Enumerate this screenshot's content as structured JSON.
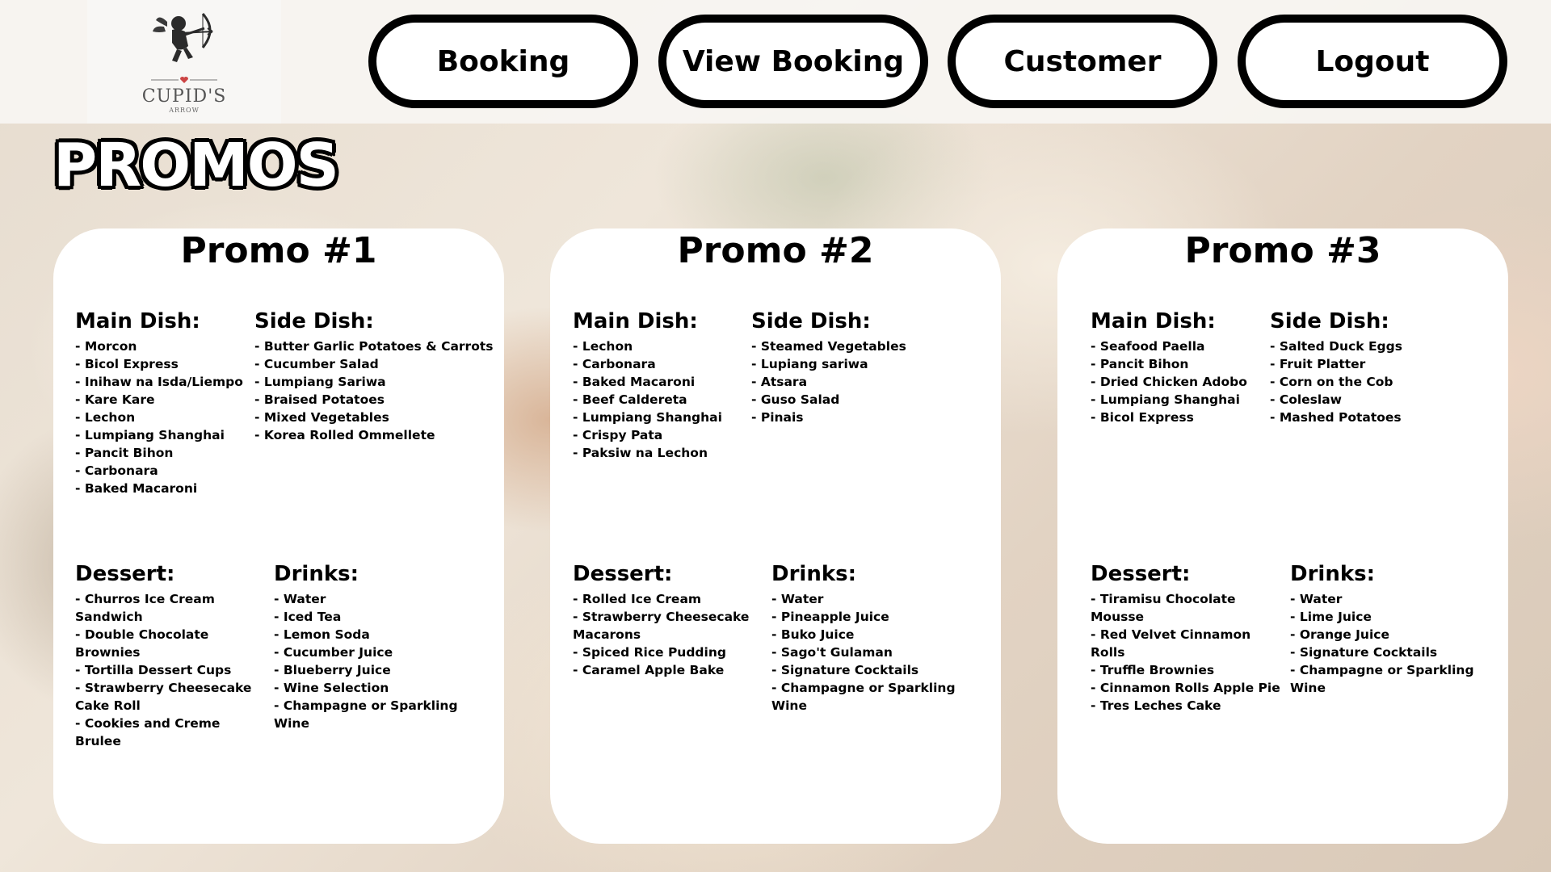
{
  "logo": {
    "name": "CUPID'S",
    "sub": "ARROW"
  },
  "nav": {
    "booking": "Booking",
    "view_booking": "View Booking",
    "customer": "Customer",
    "logout": "Logout"
  },
  "page_title": "PROMOS",
  "promos": [
    {
      "title": "Promo #1",
      "main_label": "Main Dish:",
      "main": [
        "- Morcon",
        "- Bicol Express",
        "- Inihaw na Isda/Liempo",
        "- Kare Kare",
        "- Lechon",
        "- Lumpiang Shanghai",
        "- Pancit Bihon",
        "- Carbonara",
        "- Baked Macaroni"
      ],
      "side_label": "Side Dish:",
      "side": [
        "- Butter Garlic Potatoes & Carrots",
        "- Cucumber Salad",
        "- Lumpiang Sariwa",
        "- Braised Potatoes",
        "- Mixed Vegetables",
        "- Korea Rolled Ommellete"
      ],
      "dessert_label": "Dessert:",
      "dessert": [
        "- Churros Ice Cream",
        "Sandwich",
        "- Double Chocolate",
        "Brownies",
        "- Tortilla Dessert Cups",
        "- Strawberry Cheesecake",
        "Cake Roll",
        "- Cookies and Creme",
        "Brulee"
      ],
      "drinks_label": "Drinks:",
      "drinks": [
        "- Water",
        "- Iced Tea",
        "- Lemon Soda",
        "- Cucumber Juice",
        "- Blueberry Juice",
        "- Wine Selection",
        "- Champagne or Sparkling",
        "Wine"
      ]
    },
    {
      "title": "Promo #2",
      "main_label": "Main Dish:",
      "main": [
        "- Lechon",
        "- Carbonara",
        "- Baked Macaroni",
        "- Beef Caldereta",
        "- Lumpiang Shanghai",
        "- Crispy Pata",
        "- Paksiw na Lechon"
      ],
      "side_label": "Side Dish:",
      "side": [
        "- Steamed Vegetables",
        "- Lupiang sariwa",
        "- Atsara",
        "- Guso Salad",
        "- Pinais"
      ],
      "dessert_label": "Dessert:",
      "dessert": [
        "- Rolled Ice Cream",
        "- Strawberry Cheesecake",
        "Macarons",
        "- Spiced Rice Pudding",
        "- Caramel Apple Bake"
      ],
      "drinks_label": "Drinks:",
      "drinks": [
        "- Water",
        "- Pineapple Juice",
        "- Buko Juice",
        "- Sago't Gulaman",
        "- Signature Cocktails",
        "- Champagne or Sparkling",
        "Wine"
      ]
    },
    {
      "title": "Promo #3",
      "main_label": "Main Dish:",
      "main": [
        "- Seafood Paella",
        "- Pancit Bihon",
        "- Dried Chicken Adobo",
        "- Lumpiang Shanghai",
        "- Bicol Express"
      ],
      "side_label": "Side Dish:",
      "side": [
        "- Salted Duck Eggs",
        "- Fruit Platter",
        "- Corn on the Cob",
        "- Coleslaw",
        "- Mashed Potatoes"
      ],
      "dessert_label": "Dessert:",
      "dessert": [
        "- Tiramisu Chocolate",
        "Mousse",
        "- Red Velvet Cinnamon",
        "Rolls",
        "- Truffle Brownies",
        "- Cinnamon Rolls Apple Pie",
        "- Tres Leches Cake"
      ],
      "drinks_label": "Drinks:",
      "drinks": [
        "- Water",
        "- Lime Juice",
        "- Orange Juice",
        "- Signature Cocktails",
        "- Champagne or Sparkling",
        "Wine"
      ]
    }
  ]
}
